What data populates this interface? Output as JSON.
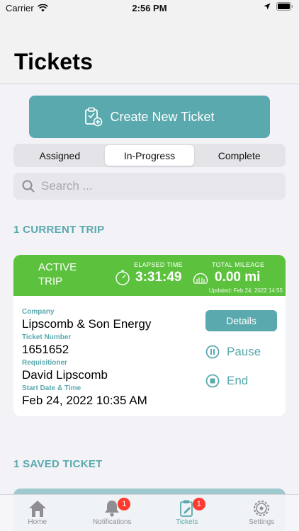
{
  "status_bar": {
    "carrier": "Carrier",
    "time": "2:56 PM"
  },
  "nav": {
    "title": "Tickets"
  },
  "create_button": {
    "label": "Create New Ticket"
  },
  "segments": {
    "items": [
      {
        "label": "Assigned"
      },
      {
        "label": "In-Progress"
      },
      {
        "label": "Complete"
      }
    ],
    "selected": "In-Progress"
  },
  "search": {
    "placeholder": "Search ..."
  },
  "current_section": {
    "title": "1 CURRENT TRIP"
  },
  "trip": {
    "status_label": "ACTIVE TRIP",
    "elapsed_label": "ELAPSED TIME",
    "elapsed_value": "3:31:49",
    "mileage_label": "TOTAL MILEAGE",
    "mileage_value": "0.00 mi",
    "updated": "Updated: Feb 24, 2022 14:55",
    "company_label": "Company",
    "company_value": "Lipscomb & Son Energy",
    "ticket_label": "Ticket Number",
    "ticket_value": "1651652",
    "requisitioner_label": "Requisitioner",
    "requisitioner_value": "David Lipscomb",
    "start_label": "Start Date & Time",
    "start_value": "Feb 24, 2022 10:35 AM",
    "details_label": "Details",
    "pause_label": "Pause",
    "end_label": "End"
  },
  "saved_section": {
    "title": "1 SAVED TICKET"
  },
  "tabbar": {
    "items": [
      {
        "label": "Home",
        "icon": "home-icon"
      },
      {
        "label": "Notifications",
        "icon": "bell-icon",
        "badge": "1"
      },
      {
        "label": "Tickets",
        "icon": "ticket-icon",
        "badge": "1"
      },
      {
        "label": "Settings",
        "icon": "gear-icon"
      }
    ],
    "selected": "Tickets"
  },
  "colors": {
    "accent": "#5aa9ae",
    "active_green": "#5cc23e",
    "badge_red": "#ff3b30"
  }
}
